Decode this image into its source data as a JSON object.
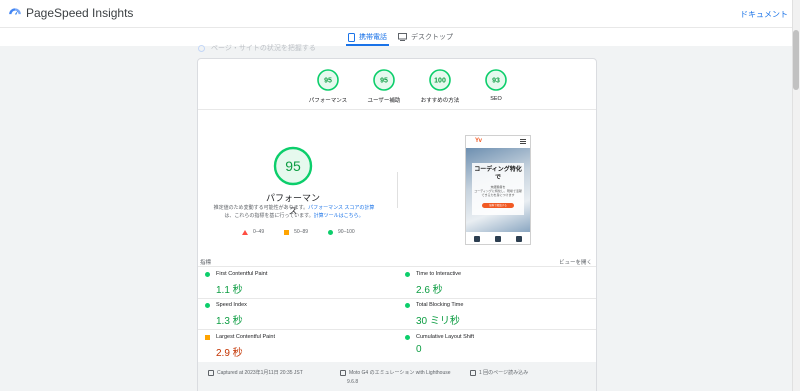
{
  "app": {
    "name": "PageSpeed Insights",
    "doc_link": "ドキュメント"
  },
  "colors": {
    "accent": "#1a73e8",
    "good": "#0cce6b",
    "good_text": "#0c9d42",
    "average": "#ffa400",
    "poor": "#ff4e42"
  },
  "device_tabs": [
    {
      "label": "携帯電話",
      "icon": "smartphone-icon",
      "active": true
    },
    {
      "label": "デスクトップ",
      "icon": "desktop-icon",
      "active": false
    }
  ],
  "faded_text": "ページ・サイトの状況を把握する",
  "categories": [
    {
      "score": "95",
      "label": "パフォーマンス"
    },
    {
      "score": "95",
      "label": "ユーザー補助"
    },
    {
      "score": "100",
      "label": "おすすめの方法"
    },
    {
      "score": "93",
      "label": "SEO"
    }
  ],
  "performance": {
    "score": "95",
    "label": "パフォーマンス",
    "desc_1": "推定値のため変動する可能性があります。",
    "desc_link_1": "パフォーマンス スコアの計算",
    "desc_2": "は、これらの指標を基に行っています。",
    "desc_link_2": "計算ツールはこちら。"
  },
  "legend": {
    "poor": "0–49",
    "average": "50–89",
    "good": "90–100"
  },
  "preview": {
    "logo_a": "Y",
    "logo_b": "v",
    "title": "コーディング特化で",
    "subtitle_line": "未経験者を",
    "caption": "コーディングに特化し、現場で活躍できる力を身につけます",
    "button": "無料で相談する"
  },
  "metrics_section": {
    "title": "指標",
    "expand": "ビューを開く"
  },
  "metrics": [
    {
      "name": "First Contentful Paint",
      "value": "1.1 秒",
      "status": "good"
    },
    {
      "name": "Time to Interactive",
      "value": "2.6 秒",
      "status": "good"
    },
    {
      "name": "Speed Index",
      "value": "1.3 秒",
      "status": "good"
    },
    {
      "name": "Total Blocking Time",
      "value": "30 ミリ秒",
      "status": "good"
    },
    {
      "name": "Largest Contentful Paint",
      "value": "2.9 秒",
      "status": "average"
    },
    {
      "name": "Cumulative Layout Shift",
      "value": "0",
      "status": "good"
    }
  ],
  "footer": {
    "captured": "Captured at 2023年1月11日 20:35 JST",
    "device": "Moto G4 のエミュレーション with Lighthouse",
    "version": "9.6.8",
    "page_load": "1 回のページ読み込み"
  }
}
